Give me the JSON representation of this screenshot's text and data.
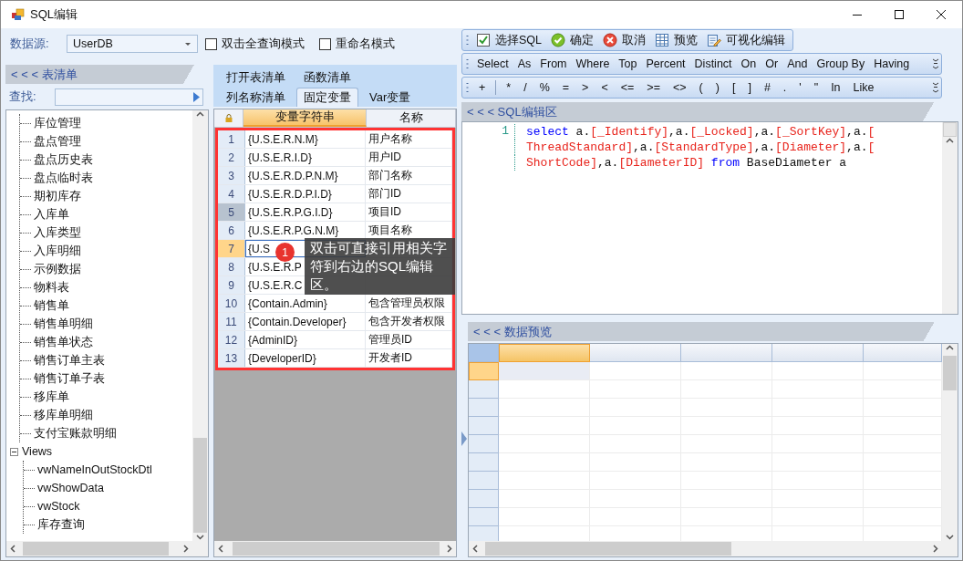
{
  "window": {
    "title": "SQL编辑"
  },
  "datasource": {
    "label": "数据源:",
    "value": "UserDB"
  },
  "options": [
    {
      "label": "双击全查询模式",
      "checked": false
    },
    {
      "label": "重命名模式",
      "checked": false
    }
  ],
  "table_list": {
    "header": "< < < 表清单",
    "search_label": "查找:",
    "tree": [
      {
        "children": [
          {
            "label": "库位管理"
          },
          {
            "label": "盘点管理"
          },
          {
            "label": "盘点历史表"
          },
          {
            "label": "盘点临时表"
          },
          {
            "label": "期初库存"
          },
          {
            "label": "入库单"
          },
          {
            "label": "入库类型"
          },
          {
            "label": "入库明细"
          },
          {
            "label": "示例数据"
          },
          {
            "label": "物料表"
          },
          {
            "label": "销售单"
          },
          {
            "label": "销售单明细"
          },
          {
            "label": "销售单状态"
          },
          {
            "label": "销售订单主表"
          },
          {
            "label": "销售订单子表"
          },
          {
            "label": "移库单"
          },
          {
            "label": "移库单明细"
          },
          {
            "label": "支付宝账款明细"
          }
        ]
      },
      {
        "label": "Views",
        "expanded": true,
        "children": [
          {
            "label": "vwNameInOutStockDtl"
          },
          {
            "label": "vwShowData"
          },
          {
            "label": "vwStock"
          },
          {
            "label": "库存查询"
          }
        ]
      }
    ]
  },
  "tab_rows": [
    {
      "tabs": [
        {
          "label": "打开表清单",
          "selected": false
        },
        {
          "label": "函数清单",
          "selected": false
        }
      ]
    },
    {
      "tabs": [
        {
          "label": "列名称清单",
          "selected": false
        },
        {
          "label": "固定变量",
          "selected": true
        },
        {
          "label": "Var变量",
          "selected": false
        }
      ]
    }
  ],
  "variables_table": {
    "columns": [
      "变量字符串",
      "名称"
    ],
    "rows": [
      {
        "number": "1",
        "variable": "{U.S.E.R.N.M}",
        "name": "用户名称",
        "selected": false,
        "current": false
      },
      {
        "number": "2",
        "variable": "{U.S.E.R.I.D}",
        "name": "用户ID",
        "selected": false,
        "current": false
      },
      {
        "number": "3",
        "variable": "{U.S.E.R.D.P.N.M}",
        "name": "部门名称",
        "selected": false,
        "current": false
      },
      {
        "number": "4",
        "variable": "{U.S.E.R.D.P.I.D}",
        "name": "部门ID",
        "selected": false,
        "current": false
      },
      {
        "number": "5",
        "variable": "{U.S.E.R.P.G.I.D}",
        "name": "项目ID",
        "selected": true,
        "current": false
      },
      {
        "number": "6",
        "variable": "{U.S.E.R.P.G.N.M}",
        "name": "项目名称",
        "selected": false,
        "current": false
      },
      {
        "number": "7",
        "variable": "{U.S",
        "selected": false,
        "current": true
      },
      {
        "number": "8",
        "variable": "{U.S.E.R.P",
        "selected": false,
        "current": false
      },
      {
        "number": "9",
        "variable": "{U.S.E.R.C",
        "selected": false,
        "current": false
      },
      {
        "number": "10",
        "variable": "{Contain.Admin}",
        "name": "包含管理员权限",
        "selected": false,
        "current": false
      },
      {
        "number": "11",
        "variable": "{Contain.Developer}",
        "name": "包含开发者权限",
        "selected": false,
        "current": false
      },
      {
        "number": "12",
        "variable": "{AdminID}",
        "name": "管理员ID",
        "selected": false,
        "current": false
      },
      {
        "number": "13",
        "variable": "{DeveloperID}",
        "name": "开发者ID",
        "selected": false,
        "current": false
      }
    ]
  },
  "tooltip": {
    "badge": "1",
    "text": "双击可直接引用相关字符到右边的SQL编辑区。"
  },
  "main_toolbar": [
    {
      "kind": "check",
      "label": "选择SQL"
    },
    {
      "kind": "ok",
      "label": "确定"
    },
    {
      "kind": "cancel",
      "label": "取消"
    },
    {
      "kind": "grid",
      "label": "预览"
    },
    {
      "kind": "edit",
      "label": "可视化编辑"
    }
  ],
  "keyword_toolbar": [
    "Select",
    "As",
    "From",
    "Where",
    "Top",
    "Percent",
    "Distinct",
    "On",
    "Or",
    "And",
    "Group By",
    "Having"
  ],
  "operator_toolbar": [
    [
      "+"
    ],
    [
      "*",
      "/",
      "%",
      "=",
      ">",
      "<",
      "<=",
      ">=",
      "<>",
      "(",
      ")",
      "[",
      "]",
      "#",
      ".",
      "'",
      "\"",
      "In",
      "Like"
    ]
  ],
  "sql_editor": {
    "header": "< < < SQL编辑区",
    "lines": [
      {
        "number": "1",
        "segments": [
          {
            "kind": "keyword",
            "text": "select"
          },
          {
            "kind": "plain",
            "text": " a."
          },
          {
            "kind": "field",
            "text": "[_Identify]"
          },
          {
            "kind": "plain",
            "text": ",a."
          },
          {
            "kind": "field",
            "text": "[_Locked]"
          },
          {
            "kind": "plain",
            "text": ",a."
          },
          {
            "kind": "field",
            "text": "[_SortKey]"
          },
          {
            "kind": "plain",
            "text": ",a."
          },
          {
            "kind": "field",
            "text": "["
          }
        ]
      },
      {
        "segments": [
          {
            "kind": "field",
            "text": "ThreadStandard]"
          },
          {
            "kind": "plain",
            "text": ",a."
          },
          {
            "kind": "field",
            "text": "[StandardType]"
          },
          {
            "kind": "plain",
            "text": ",a."
          },
          {
            "kind": "field",
            "text": "[Diameter]"
          },
          {
            "kind": "plain",
            "text": ",a."
          },
          {
            "kind": "field",
            "text": "["
          }
        ]
      },
      {
        "segments": [
          {
            "kind": "field",
            "text": "ShortCode]"
          },
          {
            "kind": "plain",
            "text": ",a."
          },
          {
            "kind": "field",
            "text": "[DiameterID]"
          },
          {
            "kind": "keyword",
            "text": " from"
          },
          {
            "kind": "plain",
            "text": " BaseDiameter a"
          }
        ]
      }
    ]
  },
  "data_preview": {
    "header": "< < < 数据预览"
  }
}
